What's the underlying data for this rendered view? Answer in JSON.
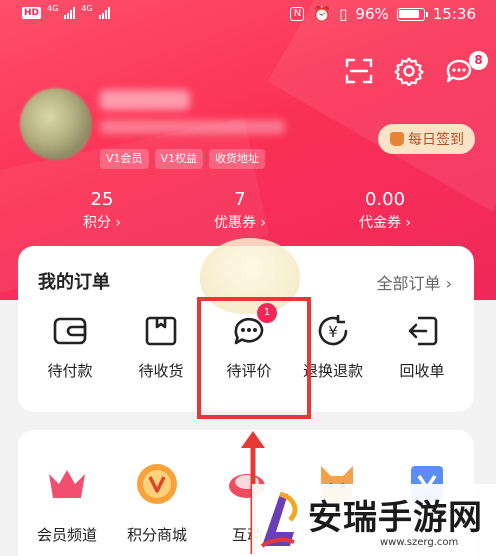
{
  "status_bar": {
    "hd": "HD",
    "net1": "4G",
    "net2": "4G",
    "nfc": "N",
    "battery": "96%",
    "time": "15:36"
  },
  "header": {
    "message_badge": "8"
  },
  "profile": {
    "tags": [
      "V1会员",
      "V1权益",
      "收货地址"
    ],
    "signin_label": "每日签到"
  },
  "stats": [
    {
      "value": "25",
      "label": "积分 ›"
    },
    {
      "value": "7",
      "label": "优惠券 ›"
    },
    {
      "value": "0.00",
      "label": "代金券 ›"
    }
  ],
  "orders": {
    "title": "我的订单",
    "all_label": "全部订单 ›",
    "items": [
      {
        "label": "待付款",
        "icon": "wallet-icon"
      },
      {
        "label": "待收货",
        "icon": "package-icon"
      },
      {
        "label": "待评价",
        "icon": "chat-icon"
      },
      {
        "label": "退换退款",
        "icon": "refund-icon"
      },
      {
        "label": "回收单",
        "icon": "recycle-icon"
      }
    ],
    "review_badge": "1"
  },
  "features": [
    {
      "label": "会员频道",
      "icon": "crown-icon"
    },
    {
      "label": "积分商城",
      "icon": "points-icon"
    },
    {
      "label": "互动",
      "icon": "game-icon"
    },
    {
      "label": "",
      "icon": "fox-icon"
    },
    {
      "label": "",
      "icon": "vip-icon"
    }
  ],
  "watermark": {
    "brand": "安瑞手游网",
    "url": "www.szerg.com"
  },
  "colors": {
    "brand": "#f0285a",
    "highlight_box": "#e53935",
    "signin_bg": "#fbe3c5"
  }
}
